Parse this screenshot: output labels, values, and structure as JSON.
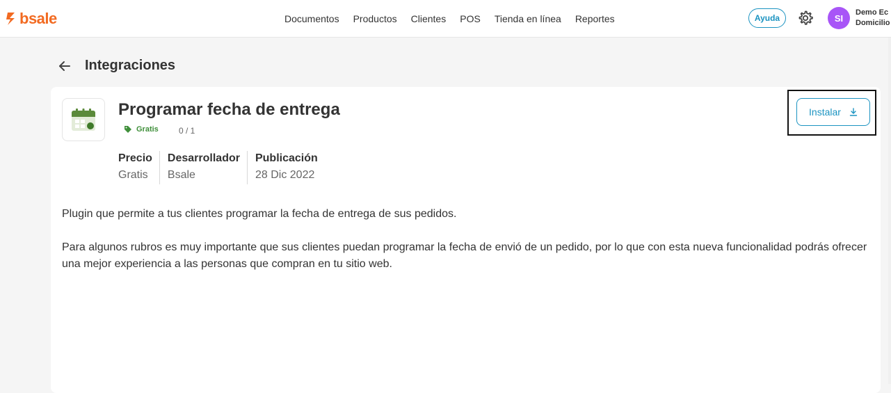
{
  "brand": {
    "name": "bsale",
    "color": "#f26a21"
  },
  "nav": {
    "links": [
      {
        "label": "Documentos"
      },
      {
        "label": "Productos"
      },
      {
        "label": "Clientes"
      },
      {
        "label": "POS"
      },
      {
        "label": "Tienda en línea"
      },
      {
        "label": "Reportes"
      }
    ],
    "help_label": "Ayuda",
    "settings_icon": "gear-icon"
  },
  "user": {
    "initials": "SI",
    "name_line1": "Demo Ec",
    "name_line2": "Domicilio",
    "avatar_color": "#a855f7"
  },
  "page": {
    "title": "Integraciones",
    "back_icon": "arrow-left-icon"
  },
  "app": {
    "title": "Programar fecha de entrega",
    "icon": "calendar-icon",
    "tag_label": "Gratis",
    "tag_icon": "tag-icon",
    "count": "0 / 1",
    "install_label": "Instalar",
    "install_icon": "download-icon",
    "meta": [
      {
        "label": "Precio",
        "value": "Gratis"
      },
      {
        "label": "Desarrollador",
        "value": "Bsale"
      },
      {
        "label": "Publicación",
        "value": "28 Dic 2022"
      }
    ],
    "description": [
      "Plugin que permite a tus clientes programar la fecha de entrega de sus pedidos.",
      "Para algunos rubros es muy importante que sus clientes puedan programar la fecha de envió de un pedido, por lo que con esta nueva funcionalidad podrás ofrecer una mejor experiencia a las personas que compran en tu sitio web."
    ]
  },
  "colors": {
    "accent": "#1b93c1",
    "tag_green": "#3f8f3a",
    "calendar_green": "#5b8a3a"
  }
}
